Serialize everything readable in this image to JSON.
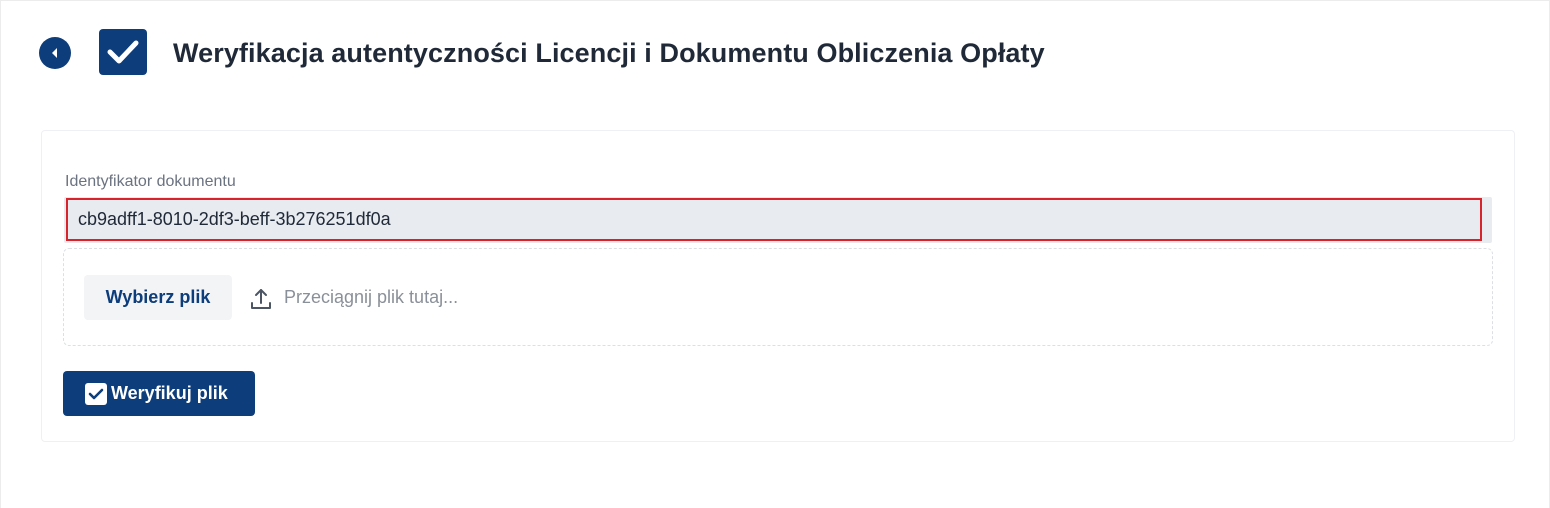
{
  "header": {
    "back_icon": "chevron-left-circle-icon",
    "title_icon": "checkbox-checked-icon",
    "title": "Weryfikacja autentyczności Licencji i Dokumentu Obliczenia Opłaty"
  },
  "form": {
    "document_id_label": "Identyfikator dokumentu",
    "document_id_value": "cb9adff1-8010-2df3-beff-3b276251df0a",
    "choose_file_label": "Wybierz plik",
    "upload_icon": "upload-icon",
    "drop_hint": "Przeciągnij plik tutaj...",
    "verify_label": "Weryfikuj plik",
    "verify_icon": "checkbox-checked-icon"
  },
  "colors": {
    "primary": "#0d3d7a",
    "error_border": "#d9232b",
    "input_bg": "#e8ebf0"
  }
}
